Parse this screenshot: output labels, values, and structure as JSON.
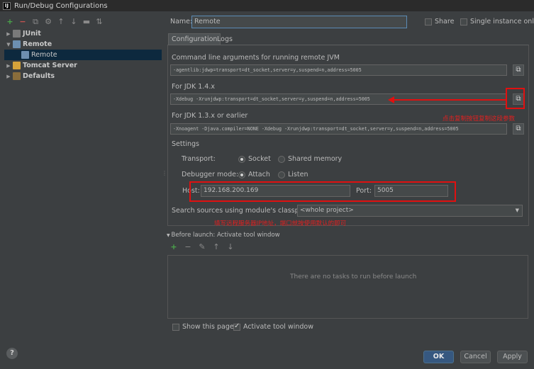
{
  "window": {
    "title": "Run/Debug Configurations",
    "app_icon_letter": "IJ"
  },
  "toolbar": {
    "icons": [
      "add-icon",
      "remove-icon",
      "copy-icon",
      "wrench-icon",
      "move-up-icon",
      "move-down-icon",
      "folder-icon",
      "sort-icon"
    ]
  },
  "tree": {
    "items": [
      {
        "label": "JUnit"
      },
      {
        "label": "Remote"
      },
      {
        "label": "Remote"
      },
      {
        "label": "Tomcat Server"
      },
      {
        "label": "Defaults"
      }
    ]
  },
  "name_field": {
    "label": "Name:",
    "value": "Remote"
  },
  "options": {
    "share_label": "Share",
    "single_instance_label": "Single instance only"
  },
  "tabs": [
    {
      "label": "Configuration"
    },
    {
      "label": "Logs"
    }
  ],
  "config": {
    "cmdline_label": "Command line arguments for running remote JVM",
    "cmdline_value": "-agentlib:jdwp=transport=dt_socket,server=y,suspend=n,address=5005",
    "jdk14_label": "For JDK 1.4.x",
    "jdk14_value": "-Xdebug -Xrunjdwp:transport=dt_socket,server=y,suspend=n,address=5005",
    "jdk13_label": "For JDK 1.3.x or earlier",
    "jdk13_value": "-Xnoagent -Djava.compiler=NONE -Xdebug -Xrunjdwp:transport=dt_socket,server=y,suspend=n,address=5005",
    "settings_label": "Settings",
    "transport_label": "Transport:",
    "transport_socket": "Socket",
    "transport_shared": "Shared memory",
    "debugger_label": "Debugger mode:",
    "debugger_attach": "Attach",
    "debugger_listen": "Listen",
    "host_label": "Host:",
    "host_value": "192.168.200.169",
    "port_label": "Port:",
    "port_value": "5005",
    "classpath_label": "Search sources using module's classpath:",
    "classpath_value": "<whole project>"
  },
  "annotations": {
    "copy_note": "点击复制按钮复制这段参数",
    "host_note": "填写远程服务器IP地址，端口就按使用默认的即可"
  },
  "before_launch": {
    "title": "Before launch: Activate tool window",
    "empty_text": "There are no tasks to run before launch"
  },
  "footer": {
    "show_page_label": "Show this page",
    "activate_label": "Activate tool window",
    "ok": "OK",
    "cancel": "Cancel",
    "apply": "Apply",
    "help": "?"
  },
  "colors": {
    "accent": "#365880",
    "annotation": "#e01010",
    "selection": "#0d293e"
  }
}
